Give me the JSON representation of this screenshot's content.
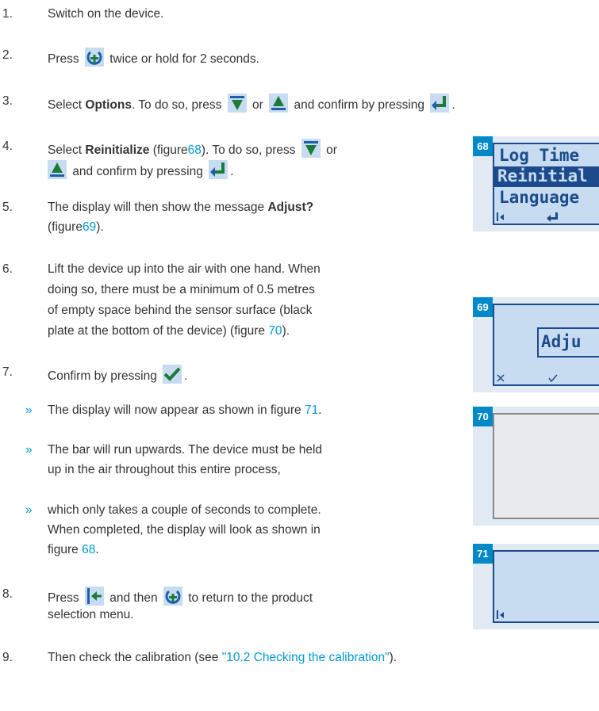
{
  "steps": [
    {
      "num": "1.",
      "text": "Switch on the device."
    },
    {
      "num": "2.",
      "pre": "Press",
      "post": "twice or hold for 2 seconds."
    },
    {
      "num": "3.",
      "pre": "Select",
      "bold": "Options",
      "mid": ". To do so, press",
      "or": "or",
      "confirm": "and confirm by pressing",
      "end": "."
    },
    {
      "num": "4.",
      "pre": "Select",
      "bold": "Reinitialize",
      "fig_pre": "(figure",
      "fig": "68",
      "fig_post": "). To do so, press",
      "or": "or",
      "confirm": "and confirm by pressing",
      "end": "."
    },
    {
      "num": "5.",
      "line1_pre": "The display will then show the message",
      "bold": "Adjust?",
      "fig_pre": "(figure",
      "fig": "69",
      "fig_post": ")."
    },
    {
      "num": "6.",
      "line1": "Lift the device up into the air with one hand. When",
      "line2": "doing so, there must be a minimum of 0.5 metres",
      "line3": "of empty space behind the sensor surface (black",
      "line4_pre": "plate at the bottom of the device) (figure",
      "fig": "70",
      "fig_post": ")."
    },
    {
      "num": "7.",
      "pre": "Confirm by pressing",
      "end": "."
    },
    {
      "num": "8.",
      "pre": "Press",
      "mid": "and then",
      "post": "to return to the product",
      "line2": "selection menu."
    },
    {
      "num": "9.",
      "pre": "Then check the calibration (see",
      "link": "\"10.2 Checking the calibration\"",
      "end": ")."
    }
  ],
  "substeps": [
    {
      "marker": "»",
      "pre": "The display will now appear as shown in figure",
      "fig": "71",
      "end": "."
    },
    {
      "marker": "»",
      "line1": "The bar will run upwards. The device must be held",
      "line2": "up in the air throughout this entire process,"
    },
    {
      "marker": "»",
      "line1": "which only takes a couple of seconds to complete.",
      "line2": "When completed, the display will look as shown in",
      "line3_pre": "figure",
      "fig": "68",
      "end": "."
    }
  ],
  "figures": [
    {
      "label": "68",
      "lines": [
        "Log Time",
        "Reinitial",
        "Language"
      ]
    },
    {
      "label": "69",
      "text": "Adju"
    },
    {
      "label": "70"
    },
    {
      "label": "71"
    }
  ],
  "icons": [
    "power-menu-icon",
    "arrow-down-icon",
    "arrow-up-icon",
    "enter-icon",
    "checkmark-icon",
    "back-icon"
  ],
  "colors": {
    "text": "#333333",
    "accent": "#009ad4",
    "label_bg": "#0089c7",
    "lcd_bg": "#c7dcf1",
    "lcd_fg": "#1d4a8c"
  }
}
